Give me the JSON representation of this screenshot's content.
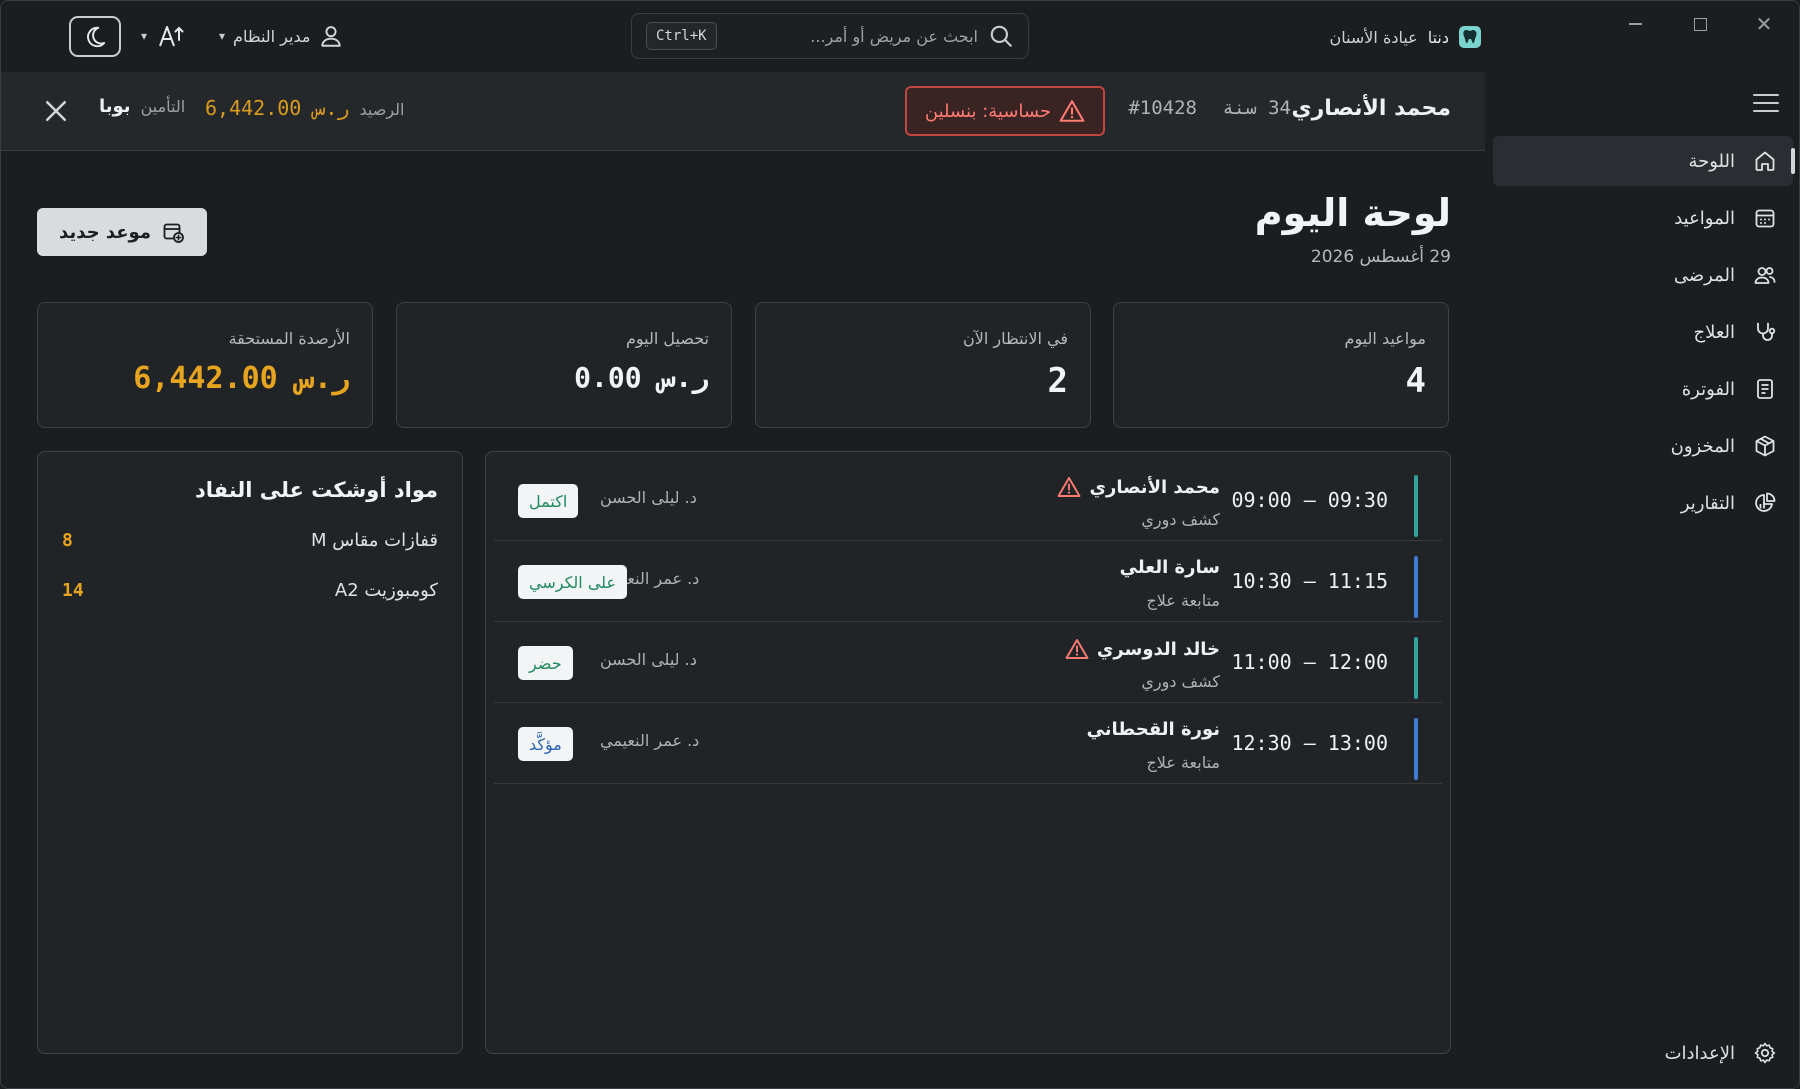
{
  "app": {
    "brand_name": "دنتا",
    "brand_sub": "عيادة الأسنان",
    "accent": "#7bd3cf"
  },
  "topbar": {
    "search_placeholder": "ابحث عن مريض أو أمر...",
    "search_shortcut": "Ctrl+K",
    "user_name": "مدير النظام",
    "window_controls": [
      "minimize",
      "maximize",
      "close"
    ]
  },
  "patient": {
    "name": "محمد الأنصاري",
    "age": "34 سنة",
    "id": "#10428",
    "allergy": "حساسية: بنسلين",
    "balance_label": "الرصيد",
    "balance_value": "6,442.00 ر.س",
    "insurance_label": "التأمين",
    "insurance_value": "بوبا",
    "colors": {
      "allergy": "#ff7b72",
      "balance": "#d99a1e"
    }
  },
  "sidebar": {
    "items": [
      {
        "label": "اللوحة",
        "icon": "home-icon",
        "active": true
      },
      {
        "label": "المواعيد",
        "icon": "calendar-icon",
        "active": false
      },
      {
        "label": "المرضى",
        "icon": "users-icon",
        "active": false
      },
      {
        "label": "العلاج",
        "icon": "stethoscope-icon",
        "active": false
      },
      {
        "label": "الفوترة",
        "icon": "invoice-icon",
        "active": false
      },
      {
        "label": "المخزون",
        "icon": "box-icon",
        "active": false
      },
      {
        "label": "التقارير",
        "icon": "report-chart-icon",
        "active": false
      }
    ],
    "settings_label": "الإعدادات"
  },
  "main": {
    "title": "لوحة اليوم",
    "date": "29 أغسطس 2026",
    "new_appointment": "موعد جديد",
    "stats": [
      {
        "label": "مواعيد اليوم",
        "value": "4"
      },
      {
        "label": "في الانتظار الآن",
        "value": "2"
      },
      {
        "label": "تحصيل اليوم",
        "value": "0.00 ر.س"
      },
      {
        "label": "الأرصدة المستحقة",
        "value": "6,442.00 ر.س"
      }
    ],
    "appointments": [
      {
        "time": "09:00 – 09:30",
        "patient": "محمد الأنصاري",
        "type": "كشف دوري",
        "doctor": "د. ليلى الحسن",
        "status": "اكتمل",
        "alert": true,
        "bar_color": "#2fa39a",
        "status_color": "#1f8a5c"
      },
      {
        "time": "10:30 – 11:15",
        "patient": "سارة العلي",
        "type": "متابعة علاج",
        "doctor": "د. عمر النعيمي",
        "status": "على الكرسي",
        "alert": false,
        "bar_color": "#3b7dd8",
        "status_color": "#1f8a5c"
      },
      {
        "time": "11:00 – 12:00",
        "patient": "خالد الدوسري",
        "type": "كشف دوري",
        "doctor": "د. ليلى الحسن",
        "status": "حضر",
        "alert": true,
        "bar_color": "#2fa39a",
        "status_color": "#1f8a5c"
      },
      {
        "time": "12:30 – 13:00",
        "patient": "نورة القحطاني",
        "type": "متابعة علاج",
        "doctor": "د. عمر النعيمي",
        "status": "مؤكَّد",
        "alert": false,
        "bar_color": "#3b7dd8",
        "status_color": "#2b63b8"
      }
    ],
    "low_stock": {
      "title": "مواد أوشكت على النفاد",
      "items": [
        {
          "name": "قفازات مقاس M",
          "qty": "8"
        },
        {
          "name": "كومبوزيت A2",
          "qty": "14"
        }
      ]
    }
  }
}
